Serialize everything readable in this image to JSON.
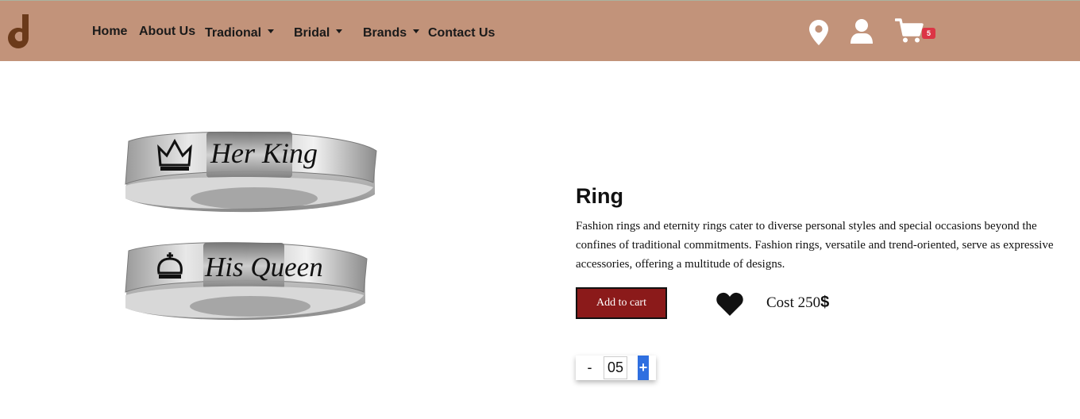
{
  "nav": {
    "logo_icon": "brand-logo-j",
    "items": [
      {
        "label": "Home",
        "dropdown": false
      },
      {
        "label": "About Us",
        "dropdown": false
      },
      {
        "label": "Tradional",
        "dropdown": true
      },
      {
        "label": "Bridal",
        "dropdown": true
      },
      {
        "label": "Brands",
        "dropdown": true
      },
      {
        "label": "Contact Us",
        "dropdown": false
      }
    ],
    "icons": [
      "location-icon",
      "user-icon",
      "cart-icon"
    ],
    "cart_count": "5",
    "colors": {
      "bar": "#c2937a",
      "badge": "#dc3545"
    }
  },
  "product": {
    "image_icon": "couple-rings-image",
    "ring_top_text": "Her King",
    "ring_bottom_text": "His Queen",
    "title": "Ring",
    "description": "Fashion rings and eternity rings cater to diverse personal styles and special occasions beyond the confines of traditional commitments. Fashion rings, versatile and trend-oriented, serve as expressive accessories, offering a multitude of designs.",
    "add_to_cart_label": "Add to cart",
    "cost_label": "Cost 250",
    "currency": "$",
    "colors": {
      "button": "#8b1a1a",
      "plus": "#2f6fe0"
    }
  },
  "quantity": {
    "minus_label": "-",
    "value": "05",
    "plus_label": "+"
  }
}
